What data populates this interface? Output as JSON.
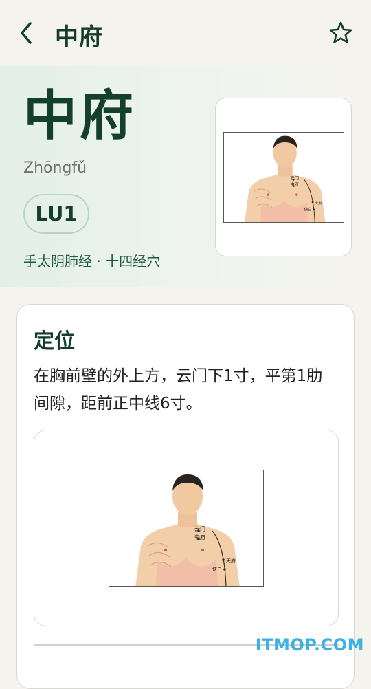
{
  "header": {
    "title": "中府",
    "back_icon": "chevron-left-icon",
    "favorite_icon": "star-outline-icon"
  },
  "hero": {
    "name": "中府",
    "pinyin": "Zhōngfǔ",
    "code": "LU1",
    "meridian": "手太阴肺经 · 十四经穴"
  },
  "figure_labels": {
    "yunmen": "云门",
    "zhongfu": "中府",
    "tianfu": "天府",
    "xiabai": "侠白"
  },
  "location": {
    "title": "定位",
    "text": "在胸前壁的外上方，云门下1寸，平第1肋间隙，距前正中线6寸。"
  },
  "watermark": "ITMOP.COM",
  "colors": {
    "primary": "#143c2a",
    "accent": "#1e5a3e",
    "badge_bg": "#e6f0ea",
    "watermark": "#3db0e8"
  }
}
